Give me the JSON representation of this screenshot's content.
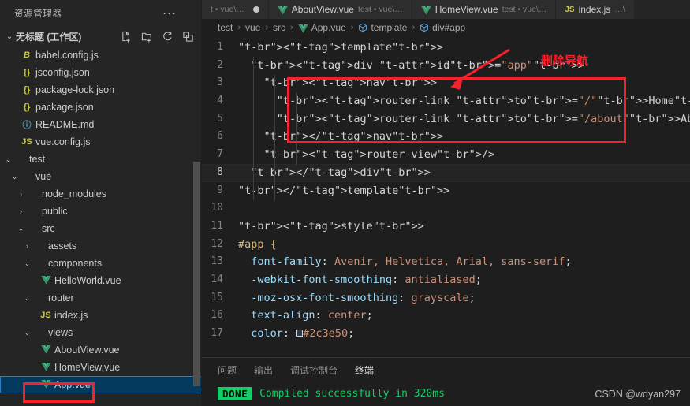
{
  "sidebar": {
    "title": "资源管理器",
    "more_label": "···",
    "workspace": {
      "label": "无标题 (工作区)",
      "twisty": "⌄"
    },
    "actions": [
      {
        "name": "new-file-icon",
        "tooltip": "新建文件"
      },
      {
        "name": "new-folder-icon",
        "tooltip": "新建文件夹"
      },
      {
        "name": "refresh-icon",
        "tooltip": "刷新"
      },
      {
        "name": "collapse-all-icon",
        "tooltip": "折叠"
      }
    ],
    "tree": [
      {
        "label": "babel.config.js",
        "icon": "babel",
        "indent": 1,
        "twisty": "",
        "selected": false
      },
      {
        "label": "jsconfig.json",
        "icon": "json",
        "indent": 1,
        "twisty": "",
        "selected": false
      },
      {
        "label": "package-lock.json",
        "icon": "json",
        "indent": 1,
        "twisty": "",
        "selected": false
      },
      {
        "label": "package.json",
        "icon": "json",
        "indent": 1,
        "twisty": "",
        "selected": false
      },
      {
        "label": "README.md",
        "icon": "md",
        "indent": 1,
        "twisty": "",
        "selected": false
      },
      {
        "label": "vue.config.js",
        "icon": "js",
        "indent": 1,
        "twisty": "",
        "selected": false
      },
      {
        "label": "test",
        "icon": "folder",
        "indent": 0,
        "twisty": "⌄",
        "selected": false
      },
      {
        "label": "vue",
        "icon": "folder",
        "indent": 1,
        "twisty": "⌄",
        "selected": false
      },
      {
        "label": "node_modules",
        "icon": "folder",
        "indent": 2,
        "twisty": "›",
        "selected": false
      },
      {
        "label": "public",
        "icon": "folder",
        "indent": 2,
        "twisty": "›",
        "selected": false
      },
      {
        "label": "src",
        "icon": "folder",
        "indent": 2,
        "twisty": "⌄",
        "selected": false
      },
      {
        "label": "assets",
        "icon": "folder",
        "indent": 3,
        "twisty": "›",
        "selected": false
      },
      {
        "label": "components",
        "icon": "folder",
        "indent": 3,
        "twisty": "⌄",
        "selected": false
      },
      {
        "label": "HelloWorld.vue",
        "icon": "vue",
        "indent": 4,
        "twisty": "",
        "selected": false
      },
      {
        "label": "router",
        "icon": "folder",
        "indent": 3,
        "twisty": "⌄",
        "selected": false
      },
      {
        "label": "index.js",
        "icon": "js",
        "indent": 4,
        "twisty": "",
        "selected": false
      },
      {
        "label": "views",
        "icon": "folder",
        "indent": 3,
        "twisty": "⌄",
        "selected": false
      },
      {
        "label": "AboutView.vue",
        "icon": "vue",
        "indent": 4,
        "twisty": "",
        "selected": false
      },
      {
        "label": "HomeView.vue",
        "icon": "vue",
        "indent": 4,
        "twisty": "",
        "selected": false
      },
      {
        "label": "App.vue",
        "icon": "vue",
        "indent": 4,
        "twisty": "",
        "selected": true
      }
    ]
  },
  "tabs": [
    {
      "name": "",
      "path": "t • vue\\…",
      "icon": "none",
      "active": false,
      "dirty": true
    },
    {
      "name": "AboutView.vue",
      "path": "test • vue\\…",
      "icon": "vue",
      "active": false,
      "dirty": false
    },
    {
      "name": "HomeView.vue",
      "path": "test • vue\\…",
      "icon": "vue",
      "active": false,
      "dirty": false
    },
    {
      "name": "index.js",
      "path": "…\\",
      "icon": "js",
      "active": false,
      "dirty": false
    }
  ],
  "breadcrumb": [
    {
      "label": "test",
      "icon": "none"
    },
    {
      "label": "vue",
      "icon": "none"
    },
    {
      "label": "src",
      "icon": "none"
    },
    {
      "label": "App.vue",
      "icon": "vue"
    },
    {
      "label": "template",
      "icon": "symbol"
    },
    {
      "label": "div#app",
      "icon": "symbol"
    }
  ],
  "breadcrumb_separator": "›",
  "editor": {
    "active_line": 8,
    "lines": [
      {
        "n": "1",
        "text": "<template>"
      },
      {
        "n": "2",
        "text": "  <div id=\"app\">"
      },
      {
        "n": "3",
        "text": "    <nav>"
      },
      {
        "n": "4",
        "text": "      <router-link to=\"/\">Home</router-link> |"
      },
      {
        "n": "5",
        "text": "      <router-link to=\"/about\">About</router-link>"
      },
      {
        "n": "6",
        "text": "    </nav>"
      },
      {
        "n": "7",
        "text": "    <router-view/>"
      },
      {
        "n": "8",
        "text": "  </div>"
      },
      {
        "n": "9",
        "text": "</template>"
      },
      {
        "n": "10",
        "text": ""
      },
      {
        "n": "11",
        "text": "<style>"
      },
      {
        "n": "12",
        "text": "#app {"
      },
      {
        "n": "13",
        "text": "  font-family: Avenir, Helvetica, Arial, sans-serif;"
      },
      {
        "n": "14",
        "text": "  -webkit-font-smoothing: antialiased;"
      },
      {
        "n": "15",
        "text": "  -moz-osx-font-smoothing: grayscale;"
      },
      {
        "n": "16",
        "text": "  text-align: center;"
      },
      {
        "n": "17",
        "text": "  color: #2c3e50;"
      }
    ],
    "color_swatch_value": "#2c3e50"
  },
  "annotation": {
    "label": "删除导航",
    "color": "#f5222d"
  },
  "panel": {
    "tabs": [
      {
        "label": "问题",
        "active": false
      },
      {
        "label": "输出",
        "active": false
      },
      {
        "label": "调试控制台",
        "active": false
      },
      {
        "label": "终端",
        "active": true
      }
    ],
    "terminal": {
      "badge": "DONE",
      "message": "Compiled successfully in 320ms",
      "badge_color": "#13ce66"
    }
  },
  "watermark": "CSDN @wdyan297"
}
